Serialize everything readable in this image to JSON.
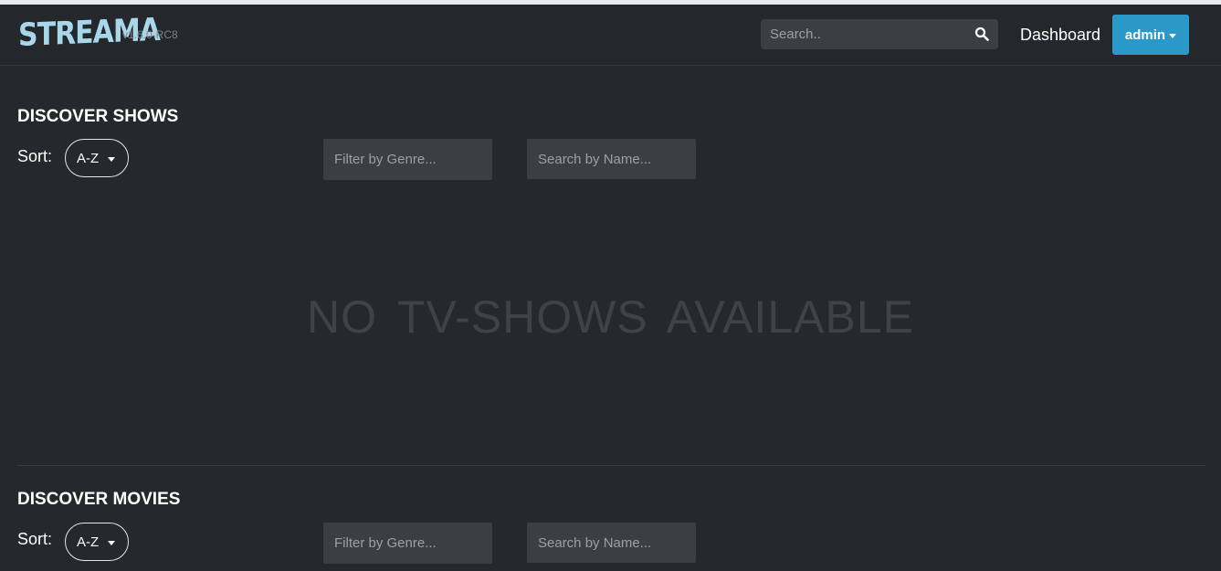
{
  "app": {
    "logo": "STREAMA",
    "version": "v1.6.0-RC8"
  },
  "navbar": {
    "search_placeholder": "Search..",
    "dashboard_label": "Dashboard",
    "user_label": "admin"
  },
  "shows": {
    "title": "DISCOVER SHOWS",
    "sort_label": "Sort:",
    "sort_value": "A-Z",
    "genre_placeholder": "Filter by Genre...",
    "name_placeholder": "Search by Name...",
    "empty_message": "NO TV-SHOWS AVAILABLE"
  },
  "movies": {
    "title": "DISCOVER MOVIES",
    "sort_label": "Sort:",
    "sort_value": "A-Z",
    "genre_placeholder": "Filter by Genre...",
    "name_placeholder": "Search by Name..."
  },
  "colors": {
    "background": "#25282c",
    "accent": "#2a98c8",
    "logo": "#a9d7ea"
  }
}
